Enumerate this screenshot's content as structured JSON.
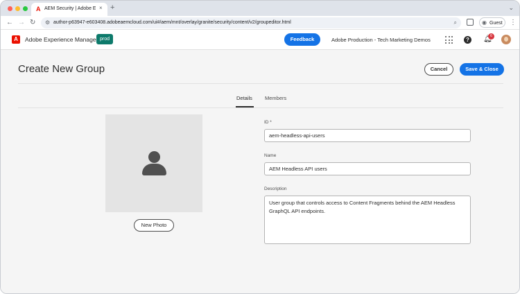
{
  "browser": {
    "tab_title": "AEM Security | Adobe Experie",
    "tab_close": "×",
    "new_tab": "+",
    "url": "author-p63947-e603408.adobeaemcloud.com/ui#/aem/mnt/overlay/granite/security/content/v2/groupeditor.html",
    "profile_label": "Guest",
    "nav": {
      "back": "←",
      "forward": "→",
      "reload": "↻",
      "menu": "⋮"
    },
    "traffic_lights": [
      "#ff5f57",
      "#febc2e",
      "#28c840"
    ]
  },
  "shell": {
    "product_name": "Adobe Experience Manager",
    "logo_letter": "A",
    "environment_badge": "prod",
    "feedback_label": "Feedback",
    "org_name": "Adobe Production - Tech Marketing Demos",
    "help_glyph": "?",
    "notification_count": "6"
  },
  "page": {
    "title": "Create New Group",
    "cancel_label": "Cancel",
    "save_label": "Save & Close",
    "tabs": [
      {
        "label": "Details",
        "active": true
      },
      {
        "label": "Members",
        "active": false
      }
    ],
    "new_photo_label": "New Photo"
  },
  "form": {
    "id_label": "ID *",
    "id_value": "aem-headless-api-users",
    "name_label": "Name",
    "name_value": "AEM Headless API users",
    "description_label": "Description",
    "description_value": "User group that controls access to Content Fragments behind the AEM Headless GraphQL API endpoints."
  },
  "colors": {
    "accent": "#1473e6",
    "adobe_red": "#eb1000",
    "prod_badge": "#0d7a6b"
  }
}
